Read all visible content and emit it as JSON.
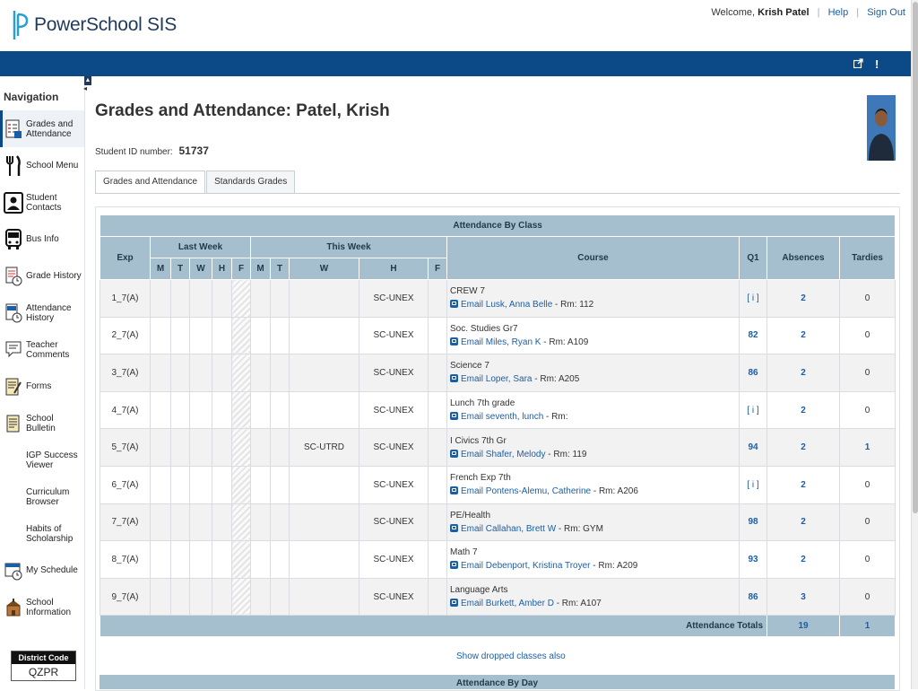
{
  "app": {
    "name": "PowerSchool SIS"
  },
  "user": {
    "welcome": "Welcome,",
    "name": "Krish Patel",
    "help": "Help",
    "signout": "Sign Out"
  },
  "sidebar": {
    "heading": "Navigation",
    "items": [
      {
        "label": "Grades and Attendance",
        "icon": "grades-attendance-icon"
      },
      {
        "label": "School Menu",
        "icon": "fork-knife-icon"
      },
      {
        "label": "Student Contacts",
        "icon": "contacts-icon"
      },
      {
        "label": "Bus Info",
        "icon": "bus-icon"
      },
      {
        "label": "Grade History",
        "icon": "grade-history-icon"
      },
      {
        "label": "Attendance History",
        "icon": "attendance-history-icon"
      },
      {
        "label": "Teacher Comments",
        "icon": "comments-icon"
      },
      {
        "label": "Forms",
        "icon": "forms-icon"
      },
      {
        "label": "School Bulletin",
        "icon": "bulletin-icon"
      },
      {
        "label": "IGP Success Viewer",
        "icon": ""
      },
      {
        "label": "Curriculum Browser",
        "icon": ""
      },
      {
        "label": "Habits of Scholarship",
        "icon": ""
      },
      {
        "label": "My Schedule",
        "icon": "schedule-icon"
      },
      {
        "label": "School Information",
        "icon": "school-icon"
      }
    ],
    "district_label": "District Code",
    "district_code": "QZPR"
  },
  "page": {
    "title": "Grades and Attendance: Patel, Krish",
    "student_id_label": "Student ID number:",
    "student_id": "51737",
    "tabs": [
      "Grades and Attendance",
      "Standards Grades"
    ]
  },
  "table": {
    "title": "Attendance By Class",
    "headers": {
      "exp": "Exp",
      "last_week": "Last Week",
      "this_week": "This Week",
      "course": "Course",
      "q1": "Q1",
      "absences": "Absences",
      "tardies": "Tardies"
    },
    "days": [
      "M",
      "T",
      "W",
      "H",
      "F"
    ],
    "rows": [
      {
        "exp": "1_7(A)",
        "tw_w": "",
        "tw_h": "SC-UNEX",
        "course": "CREW 7",
        "email": "Email Lusk, Anna Belle",
        "room": " - Rm: 112",
        "q1": "[ i ]",
        "absences": "2",
        "tardies": "0"
      },
      {
        "exp": "2_7(A)",
        "tw_w": "",
        "tw_h": "SC-UNEX",
        "course": "Soc. Studies Gr7",
        "email": "Email Miles, Ryan K",
        "room": " - Rm: A109",
        "q1": "82",
        "absences": "2",
        "tardies": "0"
      },
      {
        "exp": "3_7(A)",
        "tw_w": "",
        "tw_h": "SC-UNEX",
        "course": "Science 7",
        "email": "Email Loper, Sara",
        "room": " - Rm: A205",
        "q1": "86",
        "absences": "2",
        "tardies": "0"
      },
      {
        "exp": "4_7(A)",
        "tw_w": "",
        "tw_h": "SC-UNEX",
        "course": "Lunch 7th grade",
        "email": "Email seventh, lunch",
        "room": " - Rm:",
        "q1": "[ i ]",
        "absences": "2",
        "tardies": "0"
      },
      {
        "exp": "5_7(A)",
        "tw_w": "SC-UTRD",
        "tw_h": "SC-UNEX",
        "course": "I Civics 7th Gr",
        "email": "Email Shafer, Melody",
        "room": " - Rm: 119",
        "q1": "94",
        "absences": "2",
        "tardies": "1"
      },
      {
        "exp": "6_7(A)",
        "tw_w": "",
        "tw_h": "SC-UNEX",
        "course": "French Exp 7th",
        "email": "Email Pontens-Alemu, Catherine",
        "room": " - Rm: A206",
        "q1": "[ i ]",
        "absences": "2",
        "tardies": "0"
      },
      {
        "exp": "7_7(A)",
        "tw_w": "",
        "tw_h": "SC-UNEX",
        "course": "PE/Health",
        "email": "Email Callahan, Brett W",
        "room": " - Rm: GYM",
        "q1": "98",
        "absences": "2",
        "tardies": "0"
      },
      {
        "exp": "8_7(A)",
        "tw_w": "",
        "tw_h": "SC-UNEX",
        "course": "Math 7",
        "email": "Email Debenport, Kristina Troyer",
        "room": " - Rm: A209",
        "q1": "93",
        "absences": "2",
        "tardies": "0"
      },
      {
        "exp": "9_7(A)",
        "tw_w": "",
        "tw_h": "SC-UNEX",
        "course": "Language Arts",
        "email": "Email Burkett, Amber D",
        "room": " - Rm: A107",
        "q1": "86",
        "absences": "3",
        "tardies": "0"
      }
    ],
    "totals_label": "Attendance Totals",
    "total_absences": "19",
    "total_tardies": "1"
  },
  "dropped_link": "Show dropped classes also",
  "day_section_title": "Attendance By Day",
  "colors": {
    "brand_blue": "#0b4a86",
    "header_blue": "#a5bfcf",
    "link": "#1a5fa6"
  }
}
